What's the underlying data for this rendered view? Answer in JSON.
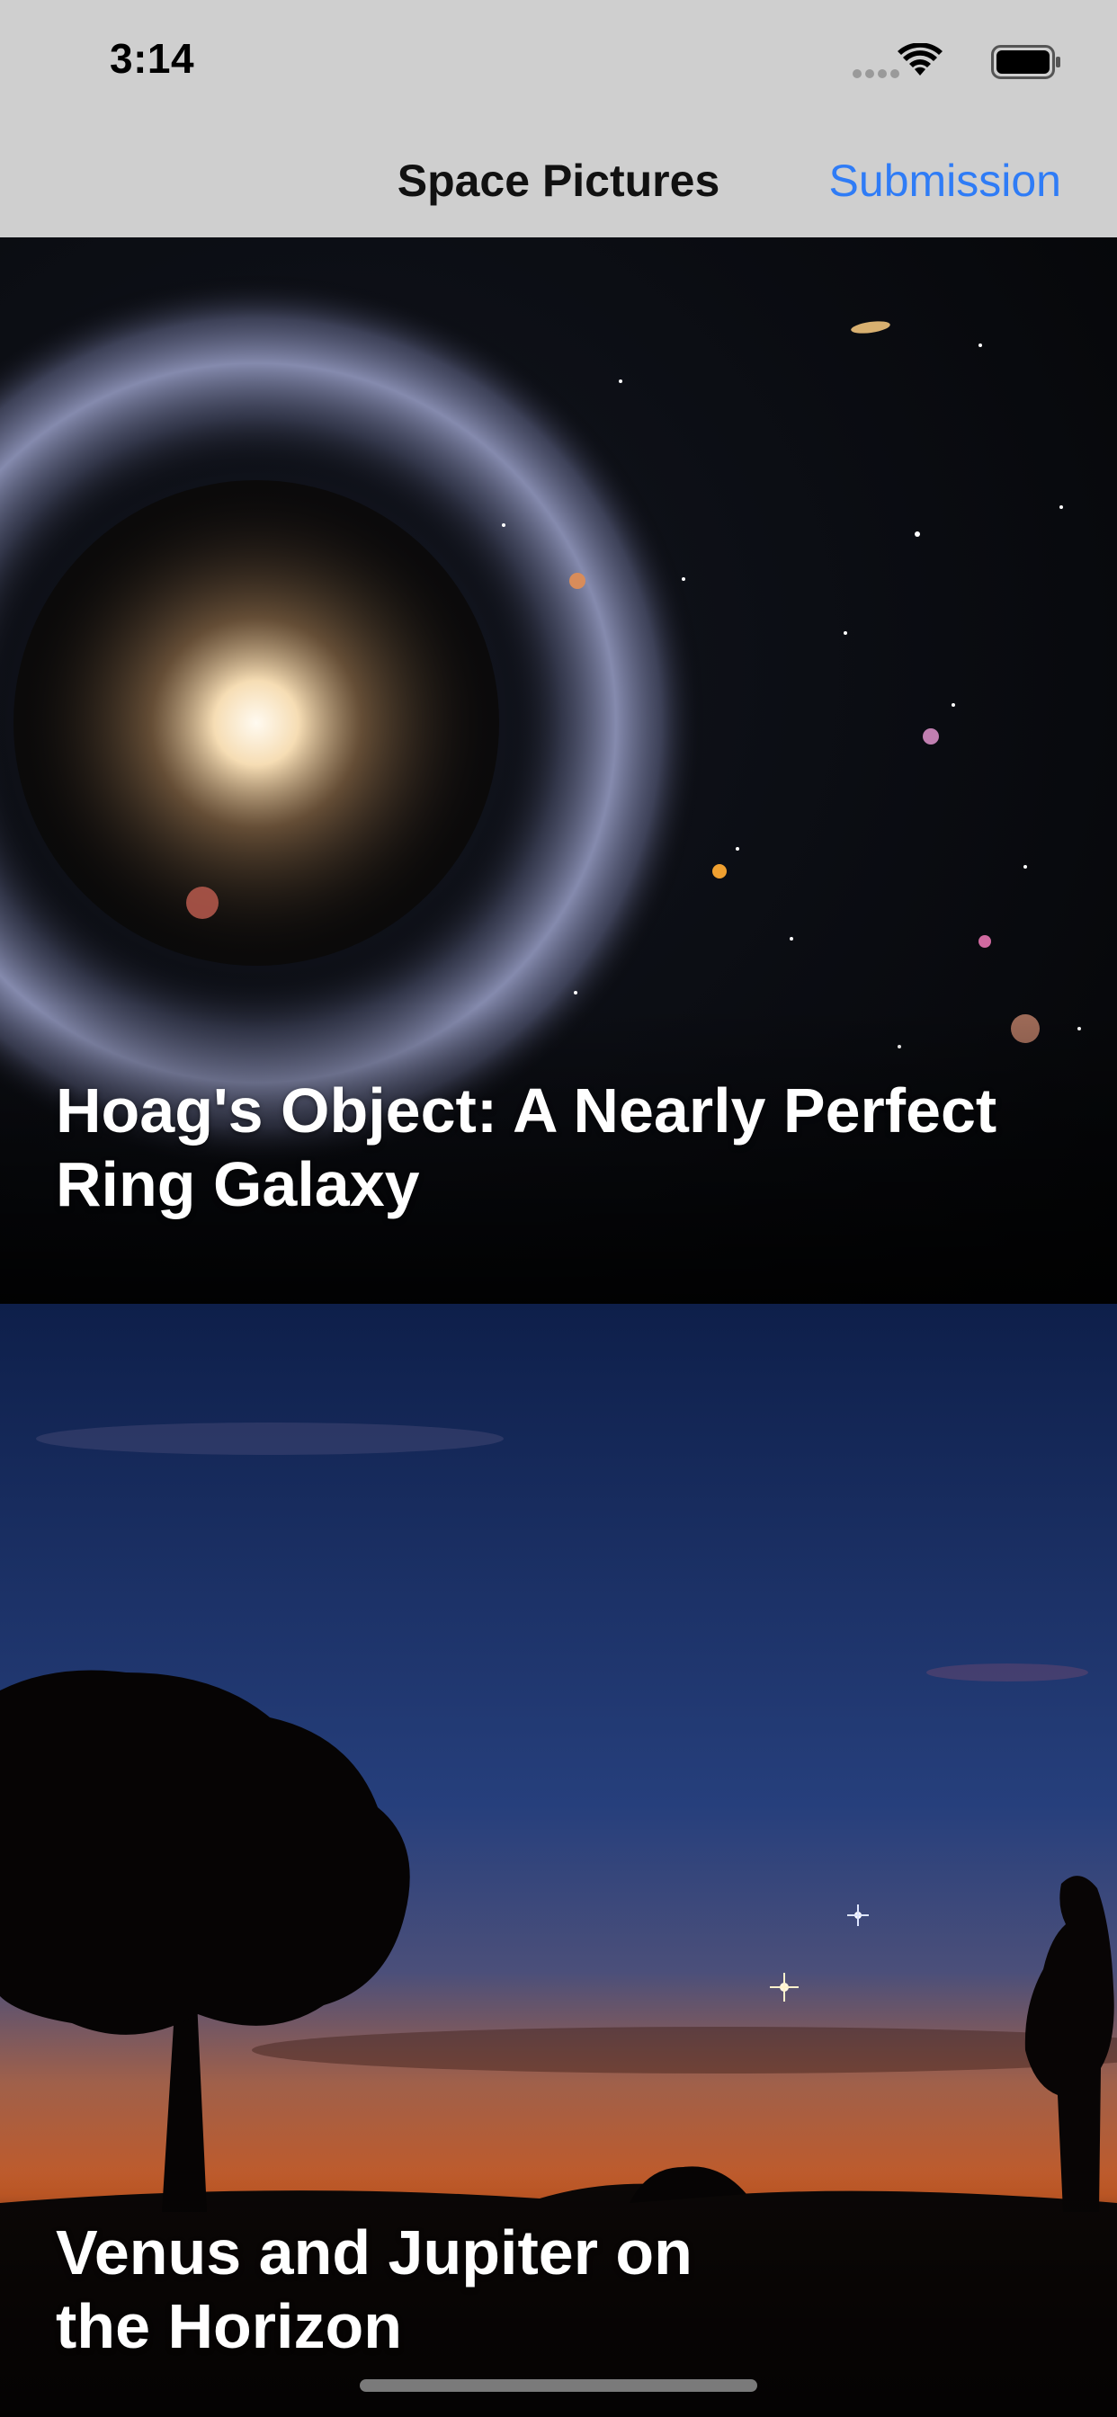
{
  "status_bar": {
    "time": "3:14"
  },
  "nav": {
    "title": "Space Pictures",
    "action_label": "Submission",
    "action_color": "#2f7cf6"
  },
  "cards": [
    {
      "title": "Hoag's Object: A Nearly Perfect Ring Galaxy",
      "image": "ring-galaxy-photo"
    },
    {
      "title": "Venus and Jupiter on the Horizon",
      "image": "twilight-horizon-photo"
    }
  ]
}
